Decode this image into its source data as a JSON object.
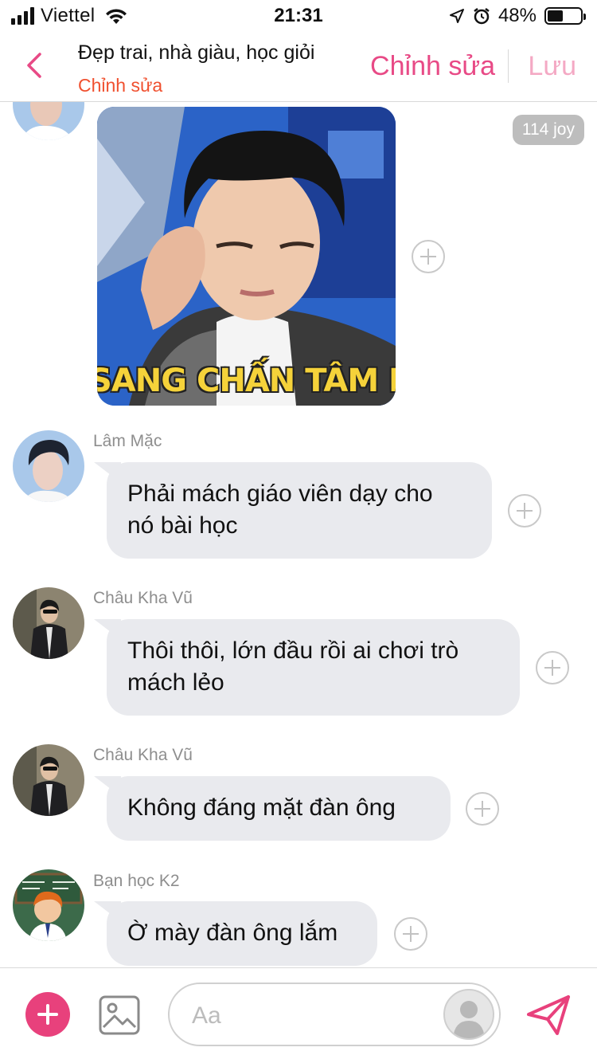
{
  "status_bar": {
    "carrier": "Viettel",
    "time": "21:31",
    "battery_percent": "48%",
    "battery_level": 0.48,
    "icons": [
      "signal-icon",
      "wifi-icon",
      "location-arrow-icon",
      "alarm-icon",
      "battery-icon"
    ]
  },
  "header": {
    "group_name": "Đẹp trai, nhà giàu, học giỏi",
    "subtitle": "Chỉnh sửa",
    "edit_label": "Chỉnh sửa",
    "save_label": "Lưu",
    "accent_color": "#e84a86",
    "save_color": "#f4a9c4",
    "subtitle_color": "#f0502f"
  },
  "photo_message": {
    "caption": "SANG CHẤN TÂM LÝ",
    "badge": "114 joy"
  },
  "messages": [
    {
      "sender": "Lâm Mặc",
      "lines": [
        "Phải mách giáo viên dạy cho",
        "nó bài học"
      ]
    },
    {
      "sender": "Châu Kha Vũ",
      "lines": [
        "Thôi thôi, lớn đầu rồi ai chơi trò",
        "mách lẻo"
      ]
    },
    {
      "sender": "Châu Kha Vũ",
      "lines": [
        "Không đáng mặt đàn ông"
      ]
    },
    {
      "sender": "Bạn học K2",
      "lines": [
        "Ờ mày đàn ông lắm"
      ]
    }
  ],
  "composer": {
    "placeholder": "Aa"
  },
  "colors": {
    "bubble": "#e9eaee",
    "plus_button": "#e8417c",
    "send_icon": "#e8417c"
  }
}
